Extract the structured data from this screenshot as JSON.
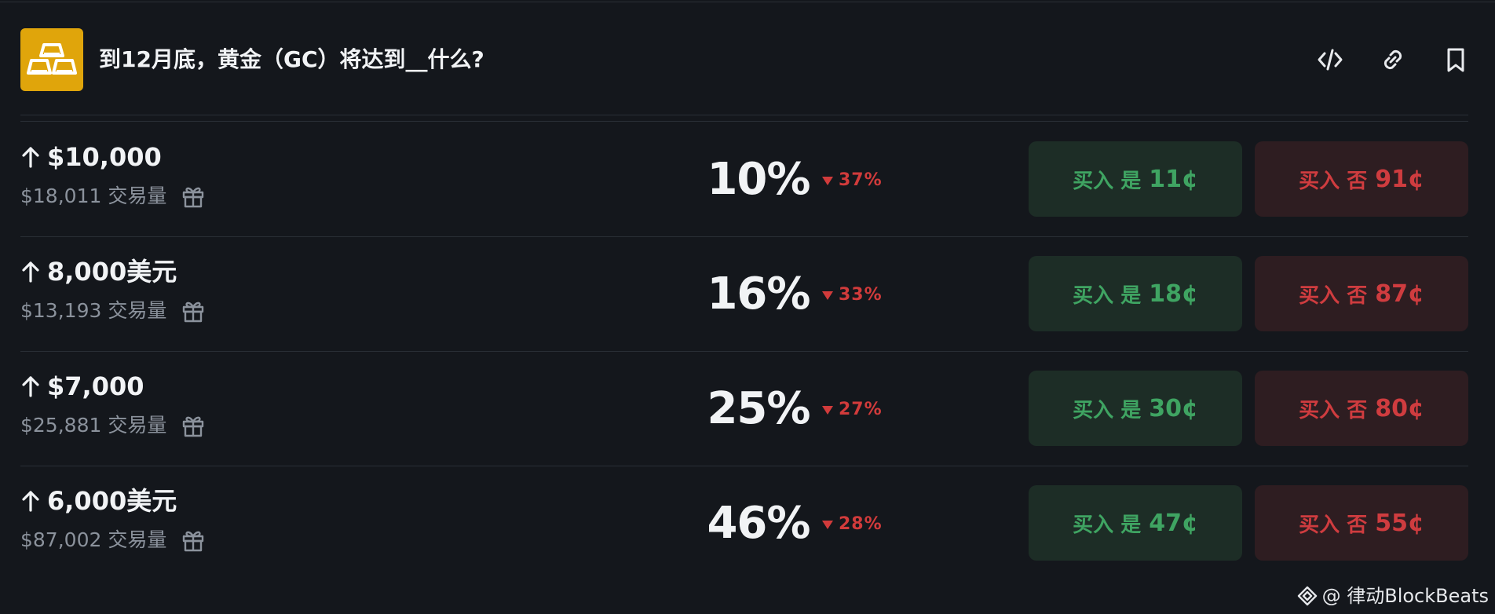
{
  "market": {
    "title": "到12月底，黄金（GC）将达到__什么?",
    "logo_icon": "gold-bars-icon",
    "logo_color": "#e0a50b"
  },
  "header_actions": [
    {
      "icon": "embed-code-icon"
    },
    {
      "icon": "link-icon"
    },
    {
      "icon": "bookmark-icon"
    }
  ],
  "outcomes": [
    {
      "direction_icon": "arrow-up-icon",
      "label": "$10,000",
      "volume": "$18,011 交易量",
      "probability": "10%",
      "change": "37%",
      "yes_label": "买入 是",
      "yes_price": "11¢",
      "no_label": "买入 否",
      "no_price": "91¢"
    },
    {
      "direction_icon": "arrow-up-icon",
      "label": "8,000美元",
      "volume": "$13,193 交易量",
      "probability": "16%",
      "change": "33%",
      "yes_label": "买入 是",
      "yes_price": "18¢",
      "no_label": "买入 否",
      "no_price": "87¢"
    },
    {
      "direction_icon": "arrow-up-icon",
      "label": "$7,000",
      "volume": "$25,881 交易量",
      "probability": "25%",
      "change": "27%",
      "yes_label": "买入 是",
      "yes_price": "30¢",
      "no_label": "买入 否",
      "no_price": "80¢"
    },
    {
      "direction_icon": "arrow-up-icon",
      "label": "6,000美元",
      "volume": "$87,002 交易量",
      "probability": "46%",
      "change": "28%",
      "yes_label": "买入 是",
      "yes_price": "47¢",
      "no_label": "买入 否",
      "no_price": "55¢"
    }
  ],
  "colors": {
    "background": "#14171c",
    "yes_text": "#3fa462",
    "yes_bg": "#1d2d26",
    "no_text": "#cf3c3f",
    "no_bg": "#2e1d21",
    "change_down": "#d13b3b"
  },
  "watermark": {
    "text": "@ 律动BlockBeats"
  }
}
